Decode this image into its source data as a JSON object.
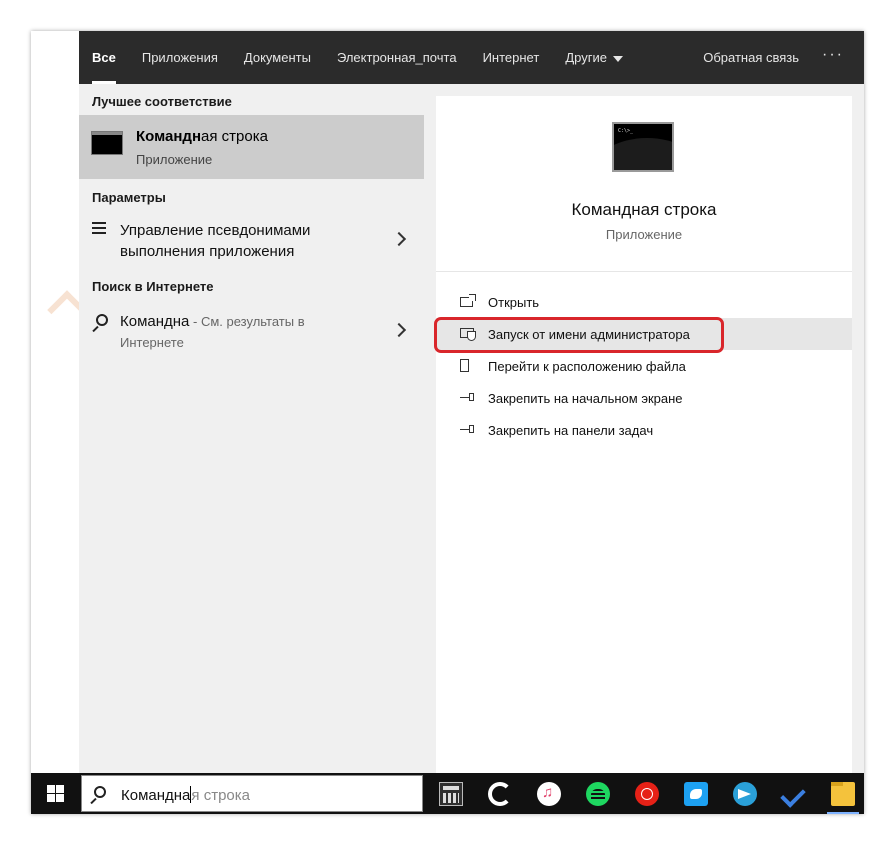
{
  "nav": {
    "tabs": [
      {
        "label": "Все"
      },
      {
        "label": "Приложения"
      },
      {
        "label": "Документы"
      },
      {
        "label": "Электронная_почта"
      },
      {
        "label": "Интернет"
      },
      {
        "label": "Другие"
      }
    ],
    "feedback_label": "Обратная связь",
    "more_label": "···"
  },
  "results": {
    "best_match_header": "Лучшее соответствие",
    "best_match": {
      "title_bold": "Командн",
      "title_rest": "ая строка",
      "subtitle": "Приложение"
    },
    "settings_header": "Параметры",
    "setting_item": "Управление псевдонимами выполнения приложения",
    "web_header": "Поиск в Интернете",
    "web_item": {
      "query": "Команднa",
      "suffix": " - См. результаты в Интернете"
    }
  },
  "preview": {
    "app_title": "Командная строка",
    "app_type": "Приложение",
    "prompt_text": "C:\\>_",
    "actions": [
      {
        "label": "Открыть",
        "icon": "open-icon"
      },
      {
        "label": "Запуск от имени администратора",
        "icon": "admin-shield-icon"
      },
      {
        "label": "Перейти к расположению файла",
        "icon": "file-location-icon"
      },
      {
        "label": "Закрепить на начальном экране",
        "icon": "pin-icon"
      },
      {
        "label": "Закрепить на панели задач",
        "icon": "pin-icon"
      }
    ]
  },
  "taskbar": {
    "search_typed": "Командна",
    "search_ghost": "я строка",
    "pinned_apps": [
      "calculator-icon",
      "swirl-app-icon",
      "itunes-icon",
      "spotify-icon",
      "youtube-music-icon",
      "twitter-icon",
      "telegram-icon",
      "todo-icon",
      "file-explorer-icon"
    ]
  },
  "colors": {
    "nav_bg": "#2b2b2b",
    "selection": "#cccccc",
    "highlight_border": "#d9262b",
    "taskbar_bg": "#111111"
  }
}
